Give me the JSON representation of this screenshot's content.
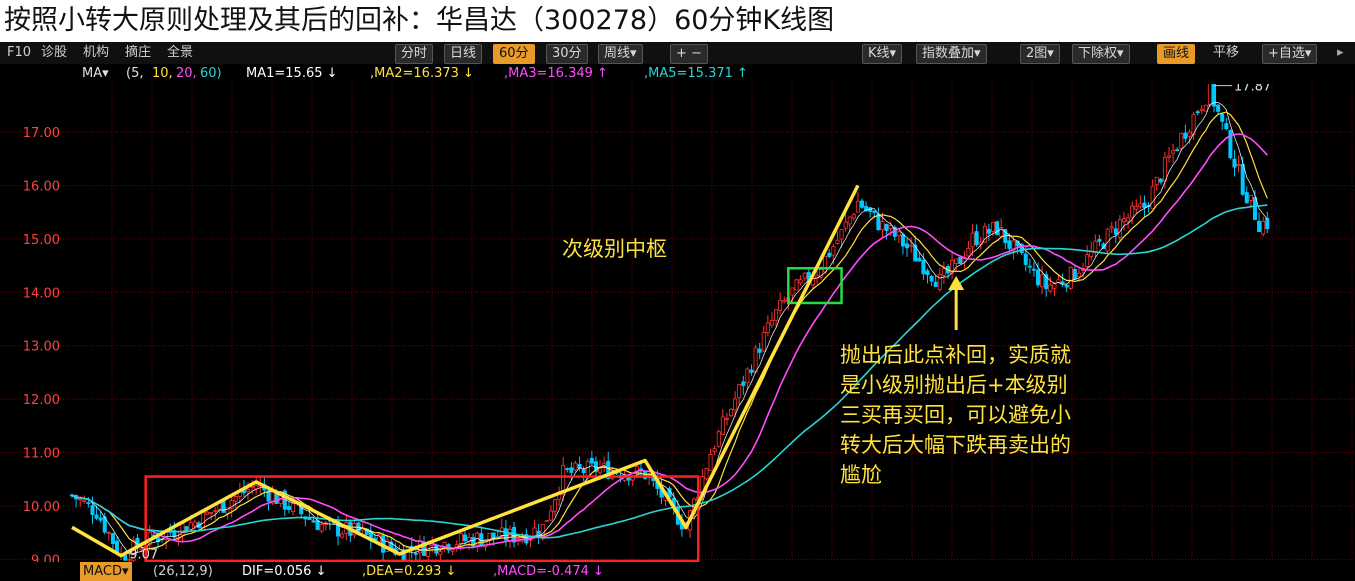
{
  "title": "按照小转大原则处理及其后的回补：华昌达（300278）60分钟K线图",
  "toolbar": {
    "left_items": [
      "F10",
      "诊股",
      "机构",
      "摘庄",
      "全景"
    ],
    "period_tabs": [
      "分时",
      "日线",
      "60分",
      "30分",
      "周线▾"
    ],
    "active_period": "60分",
    "zoom": "+ −",
    "right_items": [
      "K线▾",
      "指数叠加▾",
      "2图▾",
      "下除权▾",
      "画线",
      "平移",
      "+自选▾"
    ],
    "active_right": "画线"
  },
  "ma_bar": {
    "label": "MA▾",
    "params_open": "(5,",
    "p10": "10,",
    "p20": "20,",
    "p60": "60)",
    "ma1": "MA1=15.65 ↓",
    "ma2": ",MA2=16.373 ↓",
    "ma3": ",MA3=16.349 ↑",
    "ma5": ",MA5=15.371 ↑"
  },
  "macd_bar": {
    "label": "MACD▾",
    "params": "(26,12,9)",
    "dif": "DIF=0.056 ↓",
    "dea": ",DEA=0.293 ↓",
    "macd": ",MACD=-0.474 ↓"
  },
  "annotations": {
    "center_label": "次级别中枢",
    "explanation": [
      "抛出后此点补回，实质就",
      "是小级别抛出后+本级别",
      "三买再买回，可以避免小",
      "转大后大幅下跌再卖出的",
      "尴尬"
    ],
    "high_label": "17.87",
    "low_label": "9.07"
  },
  "colors": {
    "accent": "#e89b28",
    "up": "#ff3232",
    "down": "#00c8ff",
    "grid": "#7a0000",
    "ma1": "#ffffff",
    "ma2": "#ffe23c",
    "ma3": "#ff4cff",
    "ma4": "#2ad4d4",
    "zigzag": "#ffe23c",
    "box_red": "#ff2020",
    "box_green": "#22dd44"
  },
  "chart_data": {
    "type": "candlestick",
    "title": "",
    "y_ticks": [
      "17.00",
      "16.00",
      "15.00",
      "14.00",
      "13.00",
      "12.00",
      "11.00",
      "10.00",
      "9.00"
    ],
    "ylim": [
      8.95,
      17.9
    ],
    "zigzag_points": [
      [
        0,
        9.6
      ],
      [
        12,
        9.07
      ],
      [
        45,
        10.45
      ],
      [
        80,
        9.1
      ],
      [
        140,
        10.85
      ],
      [
        150,
        9.6
      ],
      [
        192,
        16.0
      ]
    ],
    "price_path": [
      [
        0,
        10.2
      ],
      [
        6,
        9.9
      ],
      [
        12,
        9.07
      ],
      [
        20,
        9.4
      ],
      [
        30,
        9.7
      ],
      [
        45,
        10.4
      ],
      [
        55,
        9.9
      ],
      [
        62,
        9.6
      ],
      [
        70,
        9.5
      ],
      [
        80,
        9.15
      ],
      [
        90,
        9.3
      ],
      [
        100,
        9.4
      ],
      [
        110,
        9.45
      ],
      [
        115,
        9.6
      ],
      [
        120,
        10.6
      ],
      [
        128,
        10.7
      ],
      [
        140,
        10.6
      ],
      [
        150,
        9.6
      ],
      [
        156,
        11.0
      ],
      [
        162,
        12.0
      ],
      [
        168,
        13.0
      ],
      [
        172,
        13.6
      ],
      [
        176,
        14.0
      ],
      [
        182,
        14.4
      ],
      [
        188,
        15.1
      ],
      [
        192,
        15.7
      ],
      [
        197,
        15.3
      ],
      [
        202,
        15.0
      ],
      [
        207,
        14.6
      ],
      [
        212,
        14.2
      ],
      [
        216,
        14.5
      ],
      [
        220,
        15.0
      ],
      [
        226,
        15.2
      ],
      [
        232,
        14.6
      ],
      [
        238,
        14.1
      ],
      [
        244,
        14.3
      ],
      [
        250,
        14.8
      ],
      [
        256,
        15.3
      ],
      [
        262,
        15.6
      ],
      [
        268,
        16.5
      ],
      [
        274,
        17.3
      ],
      [
        278,
        17.8
      ],
      [
        282,
        16.9
      ],
      [
        286,
        16.0
      ],
      [
        290,
        15.3
      ]
    ]
  }
}
